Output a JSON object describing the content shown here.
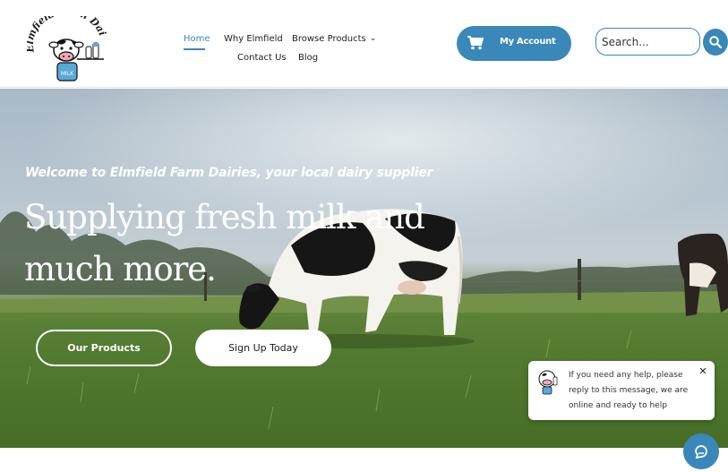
{
  "brand": {
    "logo_text": "Elmfield Farm Dairies",
    "logo_milk_text": "MILK"
  },
  "nav": {
    "items": [
      {
        "label": "Home",
        "active": true
      },
      {
        "label": "Why Elmfield",
        "active": false
      },
      {
        "label": "Browse Products",
        "active": false,
        "has_dropdown": true
      },
      {
        "label": "Contact Us",
        "active": false
      },
      {
        "label": "Blog",
        "active": false
      }
    ]
  },
  "account": {
    "label": "My Account",
    "icon": "cart-icon"
  },
  "search": {
    "placeholder": "Search...",
    "value": "",
    "button_icon": "search-icon"
  },
  "hero": {
    "subtitle": "Welcome to Elmfield Farm Dairies, your local dairy supplier",
    "title": "Supplying fresh milk and much more.",
    "buttons": {
      "products": "Our Products",
      "signup": "Sign Up Today"
    }
  },
  "chat": {
    "message": "If you need any help, please reply to this message, we are online and ready to help",
    "close_icon": "close-icon",
    "launcher_icon": "chat-icon"
  },
  "colors": {
    "accent": "#3a87b9",
    "white": "#ffffff",
    "text": "#1e1e1e"
  }
}
